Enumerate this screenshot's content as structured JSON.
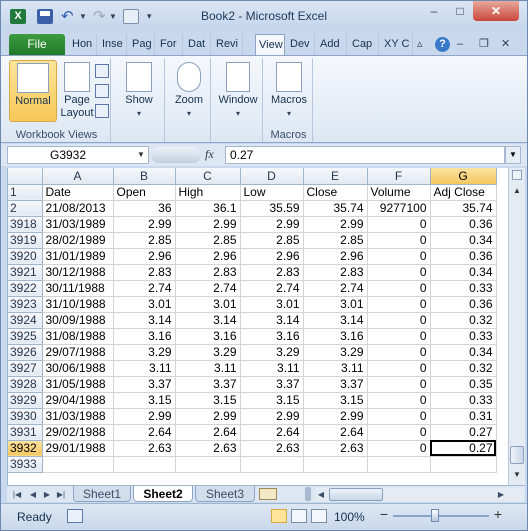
{
  "window": {
    "title": "Book2  -  Microsoft Excel"
  },
  "title_bar": {
    "app_icon_letter": "X",
    "minimize": "–",
    "maximize": "□",
    "close": "✕"
  },
  "tabs": {
    "file": "File",
    "items": [
      "Hon",
      "Inse",
      "Pag",
      "For",
      "Dat",
      "Revi",
      "View",
      "Dev",
      "Add",
      "Cap",
      "XY C"
    ],
    "active_index": 6,
    "help": "?"
  },
  "ribbon": {
    "normal": "Normal",
    "page_layout": "Page Layout",
    "workbook_views_label": "Workbook Views",
    "show": "Show",
    "zoom": "Zoom",
    "window": "Window",
    "macros": "Macros",
    "macros_label": "Macros"
  },
  "formula_bar": {
    "name_box": "G3932",
    "fx": "fx",
    "formula": "0.27"
  },
  "grid": {
    "columns": [
      "A",
      "B",
      "C",
      "D",
      "E",
      "F",
      "G"
    ],
    "active_column": "G",
    "active_row": "3932",
    "rows": [
      {
        "n": "1",
        "cells": [
          "Date",
          "Open",
          "High",
          "Low",
          "Close",
          "Volume",
          "Adj Close"
        ]
      },
      {
        "n": "2",
        "cells": [
          "21/08/2013",
          "36",
          "36.1",
          "35.59",
          "35.74",
          "9277100",
          "35.74"
        ]
      },
      {
        "n": "3918",
        "cells": [
          "31/03/1989",
          "2.99",
          "2.99",
          "2.99",
          "2.99",
          "0",
          "0.36"
        ]
      },
      {
        "n": "3919",
        "cells": [
          "28/02/1989",
          "2.85",
          "2.85",
          "2.85",
          "2.85",
          "0",
          "0.34"
        ]
      },
      {
        "n": "3920",
        "cells": [
          "31/01/1989",
          "2.96",
          "2.96",
          "2.96",
          "2.96",
          "0",
          "0.36"
        ]
      },
      {
        "n": "3921",
        "cells": [
          "30/12/1988",
          "2.83",
          "2.83",
          "2.83",
          "2.83",
          "0",
          "0.34"
        ]
      },
      {
        "n": "3922",
        "cells": [
          "30/11/1988",
          "2.74",
          "2.74",
          "2.74",
          "2.74",
          "0",
          "0.33"
        ]
      },
      {
        "n": "3923",
        "cells": [
          "31/10/1988",
          "3.01",
          "3.01",
          "3.01",
          "3.01",
          "0",
          "0.36"
        ]
      },
      {
        "n": "3924",
        "cells": [
          "30/09/1988",
          "3.14",
          "3.14",
          "3.14",
          "3.14",
          "0",
          "0.32"
        ]
      },
      {
        "n": "3925",
        "cells": [
          "31/08/1988",
          "3.16",
          "3.16",
          "3.16",
          "3.16",
          "0",
          "0.33"
        ]
      },
      {
        "n": "3926",
        "cells": [
          "29/07/1988",
          "3.29",
          "3.29",
          "3.29",
          "3.29",
          "0",
          "0.34"
        ]
      },
      {
        "n": "3927",
        "cells": [
          "30/06/1988",
          "3.11",
          "3.11",
          "3.11",
          "3.11",
          "0",
          "0.32"
        ]
      },
      {
        "n": "3928",
        "cells": [
          "31/05/1988",
          "3.37",
          "3.37",
          "3.37",
          "3.37",
          "0",
          "0.35"
        ]
      },
      {
        "n": "3929",
        "cells": [
          "29/04/1988",
          "3.15",
          "3.15",
          "3.15",
          "3.15",
          "0",
          "0.33"
        ]
      },
      {
        "n": "3930",
        "cells": [
          "31/03/1988",
          "2.99",
          "2.99",
          "2.99",
          "2.99",
          "0",
          "0.31"
        ]
      },
      {
        "n": "3931",
        "cells": [
          "29/02/1988",
          "2.64",
          "2.64",
          "2.64",
          "2.64",
          "0",
          "0.27"
        ]
      },
      {
        "n": "3932",
        "cells": [
          "29/01/1988",
          "2.63",
          "2.63",
          "2.63",
          "2.63",
          "0",
          "0.27"
        ]
      },
      {
        "n": "3933",
        "cells": [
          "",
          "",
          "",
          "",
          "",
          "",
          ""
        ]
      }
    ]
  },
  "sheets": {
    "items": [
      "Sheet1",
      "Sheet2",
      "Sheet3"
    ],
    "active_index": 1
  },
  "status_bar": {
    "status": "Ready",
    "zoom": "100%"
  }
}
